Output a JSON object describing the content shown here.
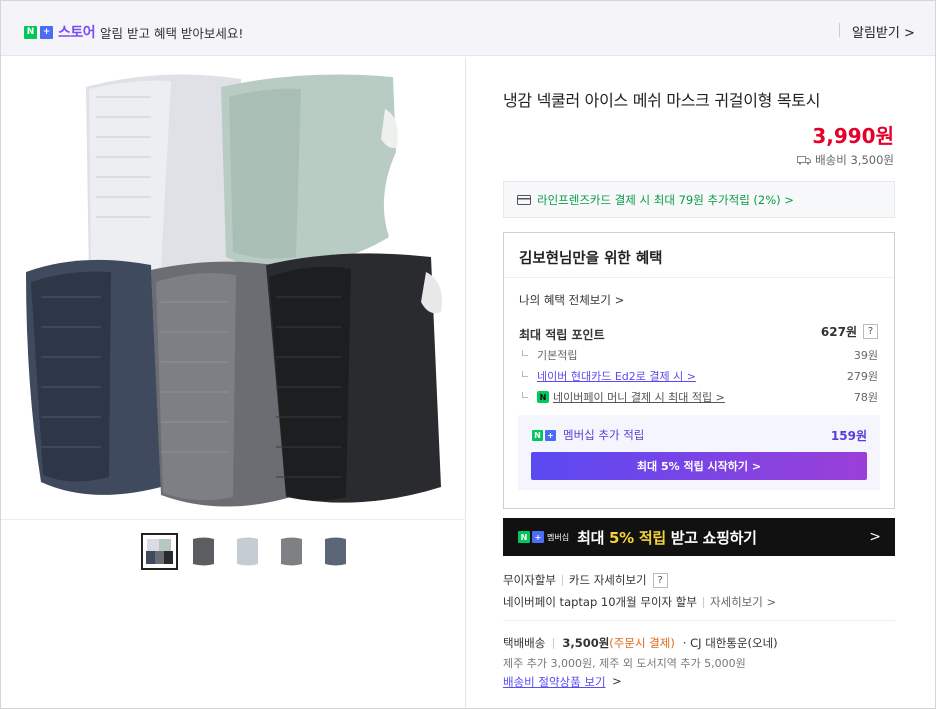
{
  "topbar": {
    "logo_n": "N",
    "logo_plus": "+",
    "store_label": "스토어",
    "message": "알림 받고 혜택 받아보세요!",
    "alarm_button": "알림받기 >"
  },
  "product": {
    "title": "냉감 넥쿨러 아이스 메쉬 마스크 귀걸이형 목토시",
    "price": "3,990원",
    "shipping": "배송비 3,500원",
    "thumbnail_count": 5
  },
  "card_promo": "라인프렌즈카드 결제 시 최대 79원 추가적립 (2%) >",
  "benefits": {
    "heading": "김보현님만을 위한 혜택",
    "my_benefits_link": "나의 혜택 전체보기 >",
    "max_points_label": "최대 적립 포인트",
    "max_points_value": "627원",
    "help": "?",
    "rows": [
      {
        "label": "기본적립",
        "value": "39원"
      },
      {
        "label": "네이버 현대카드 Ed2로 결제 시 >",
        "value": "279원"
      },
      {
        "label": "네이버페이 머니 결제 시 최대 적립 >",
        "value": "78원"
      }
    ],
    "npay_icon": "N",
    "membership": {
      "label": "멤버십 추가 적립",
      "value": "159원",
      "button": "최대 5% 적립 시작하기 >"
    }
  },
  "banner": {
    "badge": "멤버십",
    "text_prefix": "최대 ",
    "text_highlight": "5% 적립",
    "text_suffix": " 받고 쇼핑하기",
    "arrow": ">"
  },
  "payment": {
    "installment": "무이자할부",
    "card_detail": "카드 자세히보기",
    "help": "?",
    "npay_line": "네이버페이 taptap 10개월 무이자 할부",
    "npay_detail": "자세히보기 >"
  },
  "delivery": {
    "type": "택배배송",
    "fee": "3,500원",
    "fee_note": "(주문시 결제)",
    "carrier": "· CJ 대한통운(오네)",
    "extra": "제주 추가 3,000원, 제주 외 도서지역 추가 5,000원",
    "bundle_link": "배송비 절약상품 보기",
    "bundle_arrow": ">"
  },
  "colors": {
    "price_red": "#e4002b",
    "naver_green": "#03c75a",
    "membership_purple": "#5a3cd6"
  }
}
